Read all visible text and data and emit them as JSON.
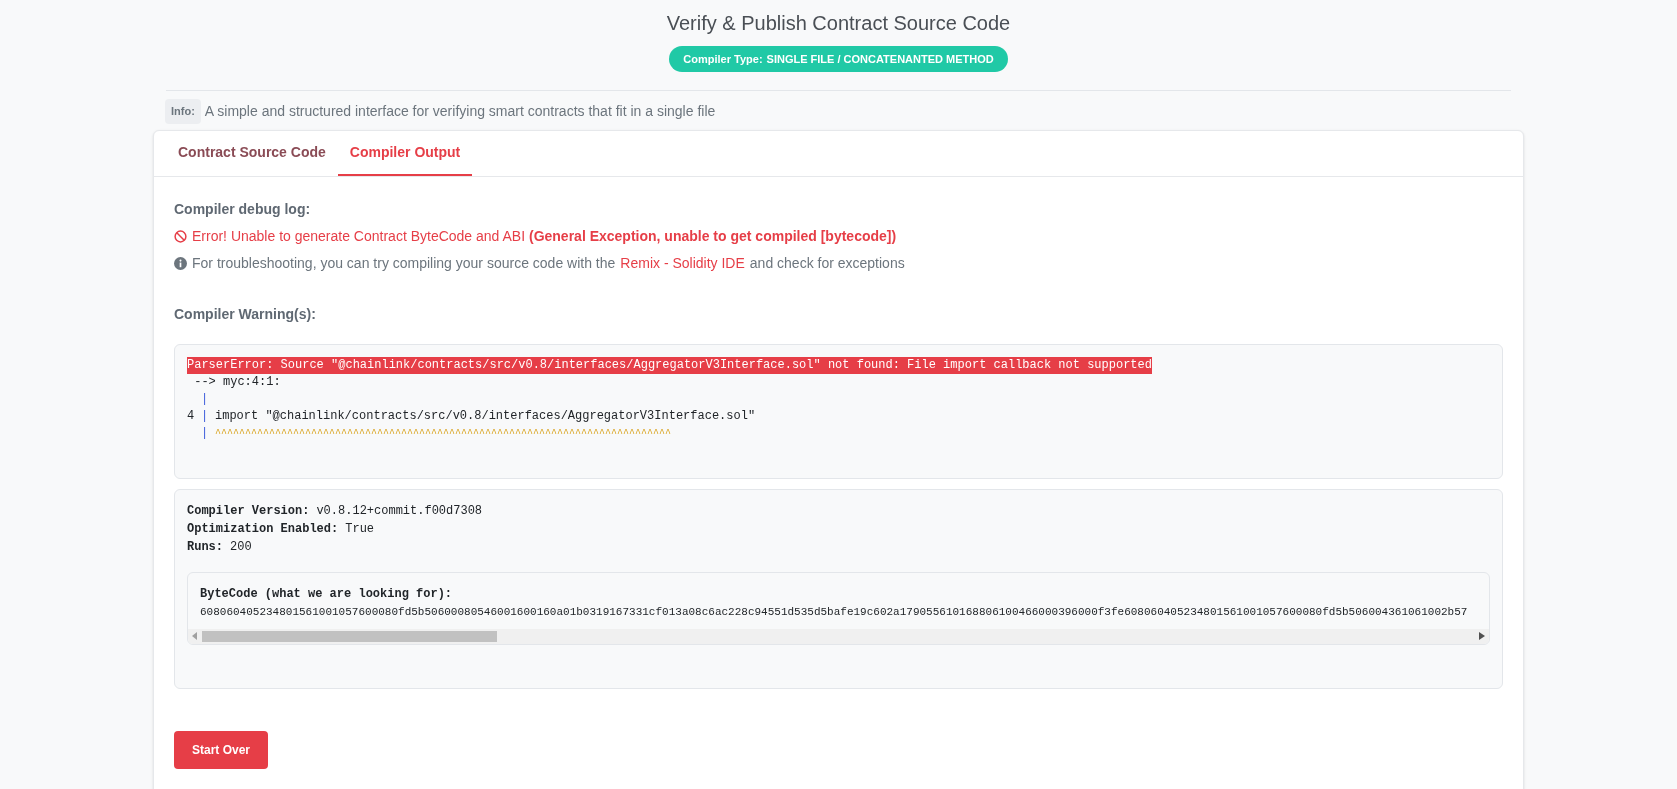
{
  "title": "Verify & Publish Contract Source Code",
  "compiler_type": {
    "label": "Compiler Type:",
    "value": "SINGLE FILE / CONCATENANTED METHOD"
  },
  "info": {
    "label": "Info:",
    "text": "A simple and structured interface for verifying smart contracts that fit in a single file"
  },
  "tabs": [
    {
      "label": "Contract Source Code",
      "selected": false
    },
    {
      "label": "Compiler Output",
      "selected": true
    }
  ],
  "debug_log": {
    "heading": "Compiler debug log:",
    "error": "Error! Unable to generate Contract ByteCode and ABI **(General Exception, unable to get compiled [bytecode])**",
    "hint_before": "For troubleshooting, you can try compiling your source code with the",
    "hint_link": "Remix - Solidity IDE",
    "hint_after": "and check for exceptions"
  },
  "warnings": {
    "heading": "Compiler Warning(s):",
    "lines": [
      {
        "kind": "error",
        "text": "ParserError: Source \"@chainlink/contracts/src/v0.8/interfaces/AggregatorV3Interface.sol\" not found: File import callback not supported"
      },
      {
        "kind": "plain",
        "text": " --> myc:4:1:"
      },
      {
        "kind": "source",
        "bar": "|"
      },
      {
        "kind": "source",
        "number": "4",
        "bar": "|",
        "text": "import \"@chainlink/contracts/src/v0.8/interfaces/AggregatorV3Interface.sol\""
      },
      {
        "kind": "caret",
        "bar": "|",
        "text": "^^^^^^^^^^^^^^^^^^^^^^^^^^^^^^^^^^^^^^^^^^^^^^^^^^^^^^^^^^^^^^^^^^^^^^^^^^^^"
      }
    ]
  },
  "compiler_info": [
    {
      "label": "Compiler Version:",
      "value": "v0.8.12+commit.f00d7308"
    },
    {
      "label": "Optimization Enabled:",
      "value": "True"
    },
    {
      "label": "Runs:",
      "value": "200"
    }
  ],
  "bytecode": {
    "label": "ByteCode (what we are looking for):",
    "value": "608060405234801561001057600080fd5b50600080546001600160a01b0319167331cf013a08c6ac228c94551d535d5bafe19c602a179055610168806100466000396000f3fe608060405234801561001057600080fd5b506004361061002b57"
  },
  "button": "Start Over"
}
